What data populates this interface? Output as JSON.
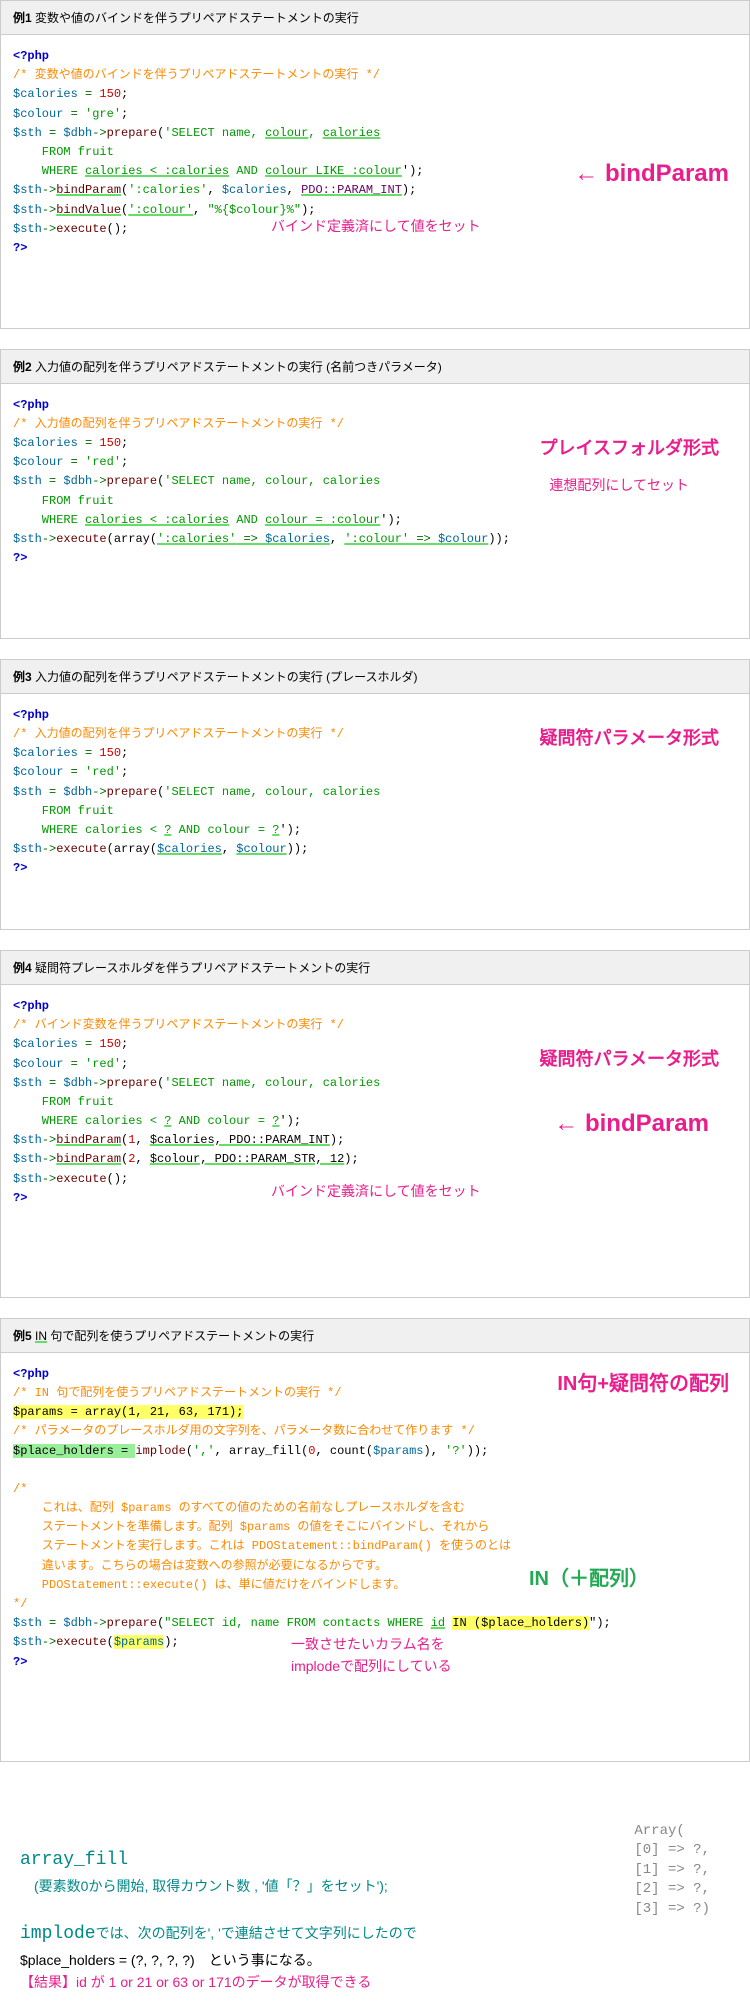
{
  "ex1": {
    "num": "例1",
    "title": "変数や値のバインドを伴うプリペアドステートメントの実行",
    "l1": "<?php",
    "l2": "/* 変数や値のバインドを伴うプリペアドステートメントの実行 */",
    "l3v": "$calories",
    "l3o": " = ",
    "l3n": "150",
    "l3s": ";",
    "l4v": "$colour",
    "l4o": " = ",
    "l4str": "'gre'",
    "l4s": ";",
    "l5v": "$sth",
    "l5o": " = ",
    "l5v2": "$dbh",
    "l5arr": "->",
    "l5f": "prepare",
    "l5p": "(",
    "l5str1": "'SELECT name, ",
    "l5ul1": "colour",
    "l5c": ", ",
    "l5ul2": "calories",
    "l6": "    FROM fruit",
    "l7a": "    WHERE ",
    "l7ul1": "calories < :calories",
    "l7and": " AND ",
    "l7ul2": "colour LIKE :colour",
    "l7end": "');",
    "l8v": "$sth",
    "l8arr": "->",
    "l8f": "bindParam",
    "l8p": "(",
    "l8s1": "':calories'",
    "l8c": ", ",
    "l8v2": "$calories",
    "l8c2": ", ",
    "l8k": "PDO::PARAM_INT",
    "l8end": ");",
    "l9v": "$sth",
    "l9arr": "->",
    "l9f": "bindValue",
    "l9p": "(",
    "l9s1": "':colour'",
    "l9c": ", ",
    "l9s2": "\"%{$colour}%\"",
    "l9end": ");",
    "l10v": "$sth",
    "l10arr": "->",
    "l10f": "execute",
    "l10end": "();",
    "l11": "?>",
    "anno1": "← bindParam",
    "anno2": "バインド定義済にして値をセット"
  },
  "ex2": {
    "num": "例2",
    "title": "入力値の配列を伴うプリペアドステートメントの実行 (名前つきパラメータ)",
    "l1": "<?php",
    "l2": "/* 入力値の配列を伴うプリペアドステートメントの実行 */",
    "l3v": "$calories",
    "l3o": " = ",
    "l3n": "150",
    "l3s": ";",
    "l4v": "$colour",
    "l4o": " = ",
    "l4str": "'red'",
    "l4s": ";",
    "l5v": "$sth",
    "l5o": " = ",
    "l5v2": "$dbh",
    "l5arr": "->",
    "l5f": "prepare",
    "l5p": "(",
    "l5str": "'SELECT name, colour, calories",
    "l6": "    FROM fruit",
    "l7a": "    WHERE ",
    "l7ul1": "calories < :calories",
    "l7and": " AND ",
    "l7ul2": "colour = :colour",
    "l7end": "');",
    "l8v": "$sth",
    "l8arr": "->",
    "l8f": "execute",
    "l8p": "(array(",
    "l8k1": "':calories'",
    "l8a1": " => ",
    "l8v2": "$calories",
    "l8c": ", ",
    "l8k2": "':colour'",
    "l8a2": " => ",
    "l8v3": "$colour",
    "l8end": "));",
    "l9": "?>",
    "anno1": "プレイスフォルダ形式",
    "anno2": "連想配列にしてセット"
  },
  "ex3": {
    "num": "例3",
    "title": "入力値の配列を伴うプリペアドステートメントの実行 (プレースホルダ)",
    "l1": "<?php",
    "l2": "/* 入力値の配列を伴うプリペアドステートメントの実行 */",
    "l3v": "$calories",
    "l3o": " = ",
    "l3n": "150",
    "l3s": ";",
    "l4v": "$colour",
    "l4o": " = ",
    "l4str": "'red'",
    "l4s": ";",
    "l5v": "$sth",
    "l5o": " = ",
    "l5v2": "$dbh",
    "l5arr": "->",
    "l5f": "prepare",
    "l5p": "(",
    "l5str": "'SELECT name, colour, calories",
    "l6": "    FROM fruit",
    "l7a": "    WHERE calories < ",
    "l7ul1": "?",
    "l7and": " AND colour = ",
    "l7ul2": "?",
    "l7end": "');",
    "l8v": "$sth",
    "l8arr": "->",
    "l8f": "execute",
    "l8p": "(array(",
    "l8v2": "$calories",
    "l8c": ", ",
    "l8v3": "$colour",
    "l8end": "));",
    "l9": "?>",
    "anno1": "疑問符パラメータ形式"
  },
  "ex4": {
    "num": "例4",
    "title": "疑問符プレースホルダを伴うプリペアドステートメントの実行",
    "l1": "<?php",
    "l2": "/* バインド変数を伴うプリペアドステートメントの実行 */",
    "l3v": "$calories",
    "l3o": " = ",
    "l3n": "150",
    "l3s": ";",
    "l4v": "$colour",
    "l4o": " = ",
    "l4str": "'red'",
    "l4s": ";",
    "l5v": "$sth",
    "l5o": " = ",
    "l5v2": "$dbh",
    "l5arr": "->",
    "l5f": "prepare",
    "l5p": "(",
    "l5str": "'SELECT name, colour, calories",
    "l6": "    FROM fruit",
    "l7a": "    WHERE calories < ",
    "l7ul1": "?",
    "l7and": " AND colour = ",
    "l7ul2": "?",
    "l7end": "');",
    "l8v": "$sth",
    "l8arr": "->",
    "l8f": "bindParam",
    "l8p": "(",
    "l8n": "1",
    "l8c": ", ",
    "l8v2": "$calories, PDO::PARAM_INT",
    "l8end": ");",
    "l9v": "$sth",
    "l9arr": "->",
    "l9f": "bindParam",
    "l9p": "(",
    "l9n": "2",
    "l9c": ", ",
    "l9v2": "$colour, PDO::PARAM_STR, 12",
    "l9end": ");",
    "l10v": "$sth",
    "l10arr": "->",
    "l10f": "execute",
    "l10end": "();",
    "l11": "?>",
    "anno1": "疑問符パラメータ形式",
    "anno2": "← bindParam",
    "anno3": "バインド定義済にして値をセット"
  },
  "ex5": {
    "num": "例5",
    "title_pre": " ",
    "title_ul": "IN",
    "title_post": " 句で配列を使うプリペアドステートメントの実行",
    "l1": "<?php",
    "l2": "/* IN 句で配列を使うプリペアドステートメントの実行 */",
    "l3hl": "$params = array(1, 21, 63, 171);",
    "l4": "/* パラメータのプレースホルダ用の文字列を、パラメータ数に合わせて作ります */",
    "l5hl": "$place_holders = ",
    "l5f": "implode",
    "l5p": "(",
    "l5s1": "','",
    "l5c": ", array_fill(",
    "l5n1": "0",
    "l5c2": ", count(",
    "l5v": "$params",
    "l5c3": "), ",
    "l5s2": "'?'",
    "l5end": "));",
    "l6": "",
    "cm1": "/*",
    "cm2": "    これは、配列 $params のすべての値のための名前なしプレースホルダを含む",
    "cm3": "    ステートメントを準備します。配列 $params の値をそこにバインドし、それから",
    "cm4": "    ステートメントを実行します。これは PDOStatement::bindParam() を使うのとは",
    "cm5": "    違います。こちらの場合は変数への参照が必要になるからです。",
    "cm6": "    PDOStatement::execute() は、単に値だけをバインドします。",
    "cm7": "*/",
    "l14v": "$sth",
    "l14o": " = ",
    "l14v2": "$dbh",
    "l14arr": "->",
    "l14f": "prepare",
    "l14p": "(",
    "l14s1": "\"SELECT id, name FROM contacts WHERE ",
    "l14ul": "id",
    "l14sp": " ",
    "l14hl": "IN ($place_holders)",
    "l14end": "\");",
    "l15v": "$sth",
    "l15arr": "->",
    "l15f": "execute",
    "l15p": "(",
    "l15hl": "$params",
    "l15end": ");",
    "l16": "?>",
    "anno1": "IN句+疑問符の配列",
    "anno2": "IN（＋配列）",
    "anno3a": "一致させたいカラム名を",
    "anno3b": "implodeで配列にしている"
  },
  "bottom": {
    "arr1": "Array(",
    "arr2": "    [0]  => ?,",
    "arr3": "    [1]  => ?,",
    "arr4": "    [2]  => ?,",
    "arr5": "    [3]  => ?)",
    "af": "array_fill",
    "afdesc": "　(要素数0から開始, 取得カウント数 , '値「？」をセット');",
    "imp_a": "implode",
    "imp_b": "では、次の配列を', 'で連結させて文字列にしたので",
    "ph": "$place_holders = (?, ?, ?, ?)　という事になる。",
    "result": "【結果】id が 1 or 21 or 63 or 171のデータが取得できる"
  }
}
